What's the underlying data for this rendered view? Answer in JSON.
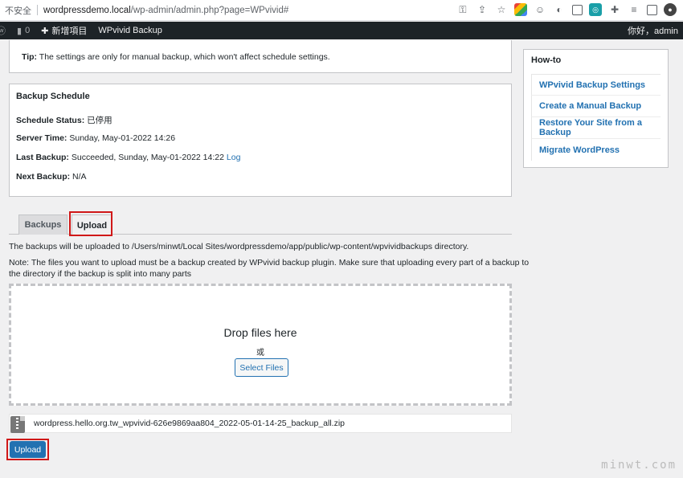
{
  "browser": {
    "security": "不安全",
    "url_domain": "wordpressdemo.local",
    "url_path": "/wp-admin/admin.php?page=WPvivid#",
    "icons": [
      "key-icon",
      "share-icon",
      "star-icon",
      "extension-icon",
      "profile-icon",
      "puzzle-icon",
      "menu-icon"
    ]
  },
  "adminbar": {
    "comments_count": "0",
    "new_label": "新增項目",
    "plugin_label": "WPvivid Backup",
    "greeting": "你好，admin"
  },
  "tip": {
    "label": "Tip:",
    "text": "The settings are only for manual backup, which won't affect schedule settings."
  },
  "schedule": {
    "title": "Backup Schedule",
    "status_label": "Schedule Status:",
    "status_value": "已停用",
    "server_time_label": "Server Time:",
    "server_time_value": "Sunday, May-01-2022 14:26",
    "last_backup_label": "Last Backup:",
    "last_backup_value": "Succeeded, Sunday, May-01-2022 14:22",
    "log_link": "Log",
    "next_backup_label": "Next Backup:",
    "next_backup_value": "N/A"
  },
  "tabs": {
    "backups": "Backups",
    "upload": "Upload"
  },
  "upload_panel": {
    "directory_note": "The backups will be uploaded to /Users/minwt/Local Sites/wordpressdemo/app/public/wp-content/wpvividbackups directory.",
    "note_line1": "Note: The files you want to upload must be a backup created by WPvivid backup plugin. Make sure that uploading every part of a backup to",
    "note_line2": "the directory if the backup is split into many parts",
    "drop_title": "Drop files here",
    "or": "或",
    "select_files": "Select Files",
    "file_name": "wordpress.hello.org.tw_wpvivid-626e9869aa804_2022-05-01-14-25_backup_all.zip",
    "upload_button": "Upload"
  },
  "howto": {
    "title": "How-to",
    "items": [
      "WPvivid Backup Settings",
      "Create a Manual Backup",
      "Restore Your Site from a Backup",
      "Migrate WordPress"
    ]
  },
  "watermark": "minwt.com",
  "colors": {
    "primary": "#2271b1",
    "highlight": "#d01818",
    "adminbar": "#1d2327"
  }
}
